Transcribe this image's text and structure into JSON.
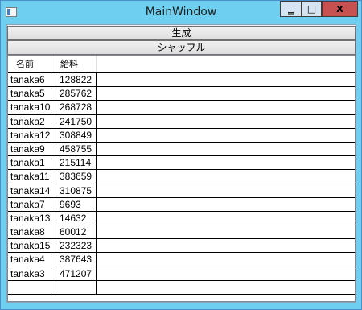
{
  "window": {
    "title": "MainWindow"
  },
  "caption_buttons": {
    "minimize": "‗",
    "maximize": "□",
    "close": "x"
  },
  "buttons": {
    "generate": "生成",
    "shuffle": "シャッフル"
  },
  "grid": {
    "columns": [
      "名前",
      "給料"
    ],
    "rows": [
      {
        "name": "tanaka6",
        "salary": "128822"
      },
      {
        "name": "tanaka5",
        "salary": "285762"
      },
      {
        "name": "tanaka10",
        "salary": "268728"
      },
      {
        "name": "tanaka2",
        "salary": "241750"
      },
      {
        "name": "tanaka12",
        "salary": "308849"
      },
      {
        "name": "tanaka9",
        "salary": "458755"
      },
      {
        "name": "tanaka1",
        "salary": "215114"
      },
      {
        "name": "tanaka11",
        "salary": "383659"
      },
      {
        "name": "tanaka14",
        "salary": "310875"
      },
      {
        "name": "tanaka7",
        "salary": "9693"
      },
      {
        "name": "tanaka13",
        "salary": "14632"
      },
      {
        "name": "tanaka8",
        "salary": "60012"
      },
      {
        "name": "tanaka15",
        "salary": "232323"
      },
      {
        "name": "tanaka4",
        "salary": "387643"
      },
      {
        "name": "tanaka3",
        "salary": "471207"
      },
      {
        "name": "",
        "salary": ""
      }
    ]
  }
}
